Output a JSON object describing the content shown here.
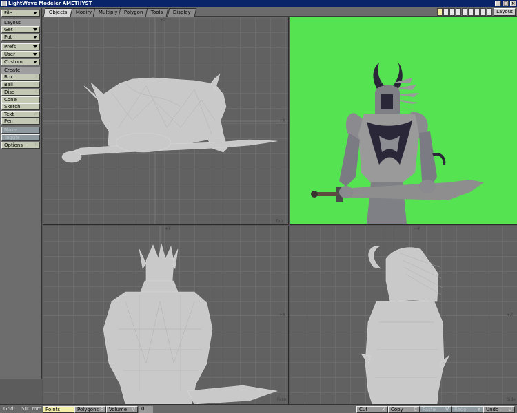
{
  "window": {
    "title": "LightWave Modeler AMETHYST"
  },
  "tabs": [
    {
      "label": "Objects",
      "active": true
    },
    {
      "label": "Modify",
      "active": false
    },
    {
      "label": "Multiply",
      "active": false
    },
    {
      "label": "Polygon",
      "active": false
    },
    {
      "label": "Tools",
      "active": false
    },
    {
      "label": "Display",
      "active": false
    }
  ],
  "layout_button": "Layout",
  "sidebar": {
    "file": "File",
    "layout_header": "Layout",
    "get": "Get",
    "put": "Put",
    "prefs": "Prefs",
    "user": "User",
    "custom": "Custom",
    "create_header": "Create",
    "box": "Box",
    "box_key": "X",
    "ball": "Ball",
    "ball_key": "O",
    "disc": "Disc",
    "disc_key": "C",
    "cone": "Cone",
    "sketch": "Sketch",
    "text": "Text",
    "text_key": "W",
    "pen": "Pen",
    "pen_key": "P",
    "make": "Make",
    "toggle": "Toggle",
    "options": "Options",
    "options_key": "N"
  },
  "viewports": {
    "top": {
      "axis_v": "+Z",
      "axis_h": "+X",
      "view": "Top"
    },
    "front": {
      "axis_v": "+Y",
      "axis_h": "+X",
      "view": "Face"
    },
    "side": {
      "axis_v": "+Y",
      "axis_h": "+Z",
      "view": "Side"
    }
  },
  "statusbar": {
    "grid_label": "Grid:",
    "grid_value": "500 mm",
    "points": "Points",
    "polygons": "Polygons",
    "polygons_n": "P",
    "volume": "Volume",
    "volume_n": "V",
    "count": "0",
    "cut": "Cut",
    "cut_key": "X",
    "copy": "Copy",
    "copy_key": "C",
    "paste": "Paste",
    "paste_key": "V",
    "redo": "Redo",
    "redo_key": "Y",
    "undo": "Undo",
    "undo_key": "U"
  },
  "colors": {
    "titlebar": "#0a246a",
    "camera_bg": "#55e352",
    "wireframe": "#c9c9c9",
    "armor_dark": "#2a2838",
    "armor_light": "#9a9a9a"
  },
  "icons": [
    "app-icon",
    "minimize-icon",
    "maximize-icon",
    "close-icon",
    "dropdown-arrow-icon"
  ]
}
